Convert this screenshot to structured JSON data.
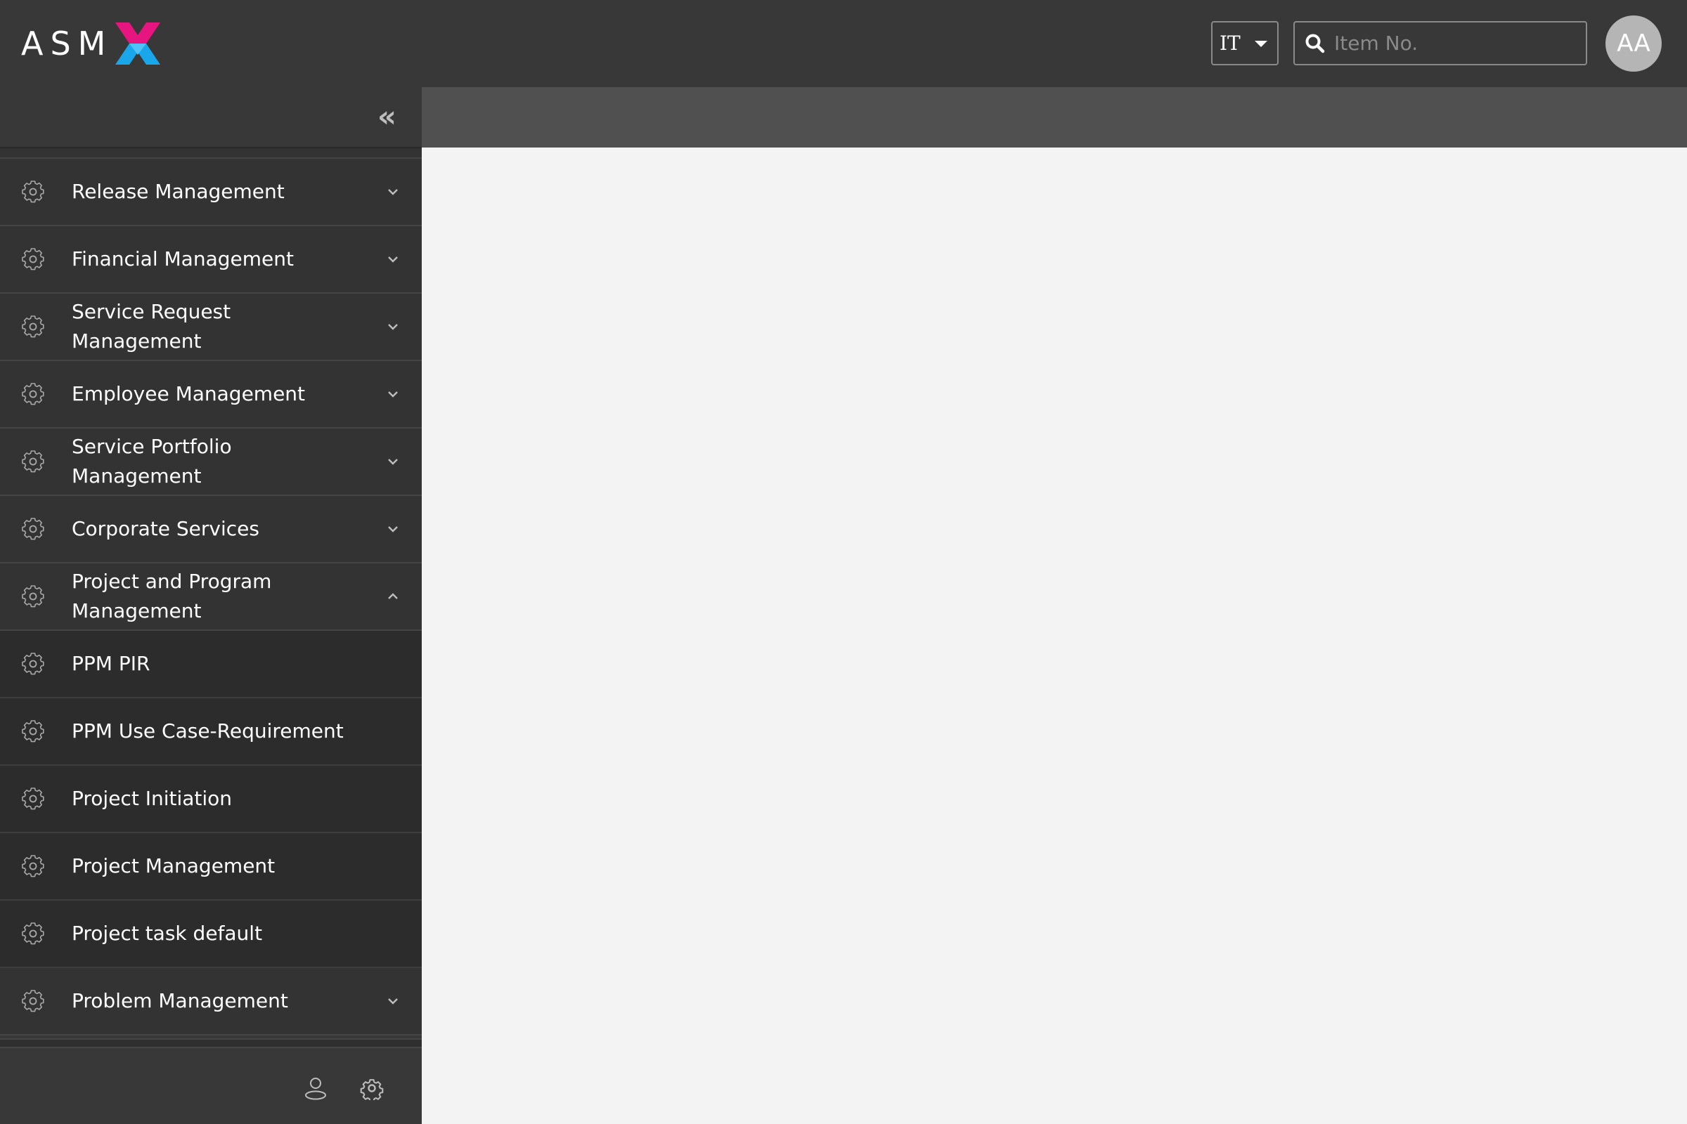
{
  "header": {
    "logo_text": "ASM",
    "domain_select": {
      "selected": "IT"
    },
    "search": {
      "placeholder": "Item No.",
      "value": ""
    },
    "avatar_initials": "AA"
  },
  "colors": {
    "logo_magenta": "#e6157f",
    "logo_blue": "#1aa6ea",
    "topbar_bg": "#383838",
    "subbar_bg": "#505050",
    "content_bg": "#f3f3f3",
    "avatar_bg": "#b5b5b5"
  },
  "sidebar": {
    "collapse_icon": "double-chevron-left-icon",
    "items": [
      {
        "label": "Release Management",
        "icon": "gear-icon",
        "expandable": true,
        "expanded": false
      },
      {
        "label": "Financial Management",
        "icon": "gear-icon",
        "expandable": true,
        "expanded": false
      },
      {
        "label": "Service Request Management",
        "icon": "gear-icon",
        "expandable": true,
        "expanded": false
      },
      {
        "label": "Employee Management",
        "icon": "gear-icon",
        "expandable": true,
        "expanded": false
      },
      {
        "label": "Service Portfolio Management",
        "icon": "gear-icon",
        "expandable": true,
        "expanded": false
      },
      {
        "label": "Corporate Services",
        "icon": "gear-icon",
        "expandable": true,
        "expanded": false
      },
      {
        "label": "Project and Program Management",
        "icon": "gear-icon",
        "expandable": true,
        "expanded": true,
        "children": [
          {
            "label": "PPM PIR",
            "icon": "gear-icon"
          },
          {
            "label": "PPM Use Case-Requirement",
            "icon": "gear-icon"
          },
          {
            "label": "Project Initiation",
            "icon": "gear-icon"
          },
          {
            "label": "Project Management",
            "icon": "gear-icon"
          },
          {
            "label": "Project task default",
            "icon": "gear-icon"
          }
        ]
      },
      {
        "label": "Problem Management",
        "icon": "gear-icon",
        "expandable": true,
        "expanded": false
      }
    ],
    "footer": {
      "icons": [
        "user-icon",
        "settings-icon"
      ]
    }
  }
}
